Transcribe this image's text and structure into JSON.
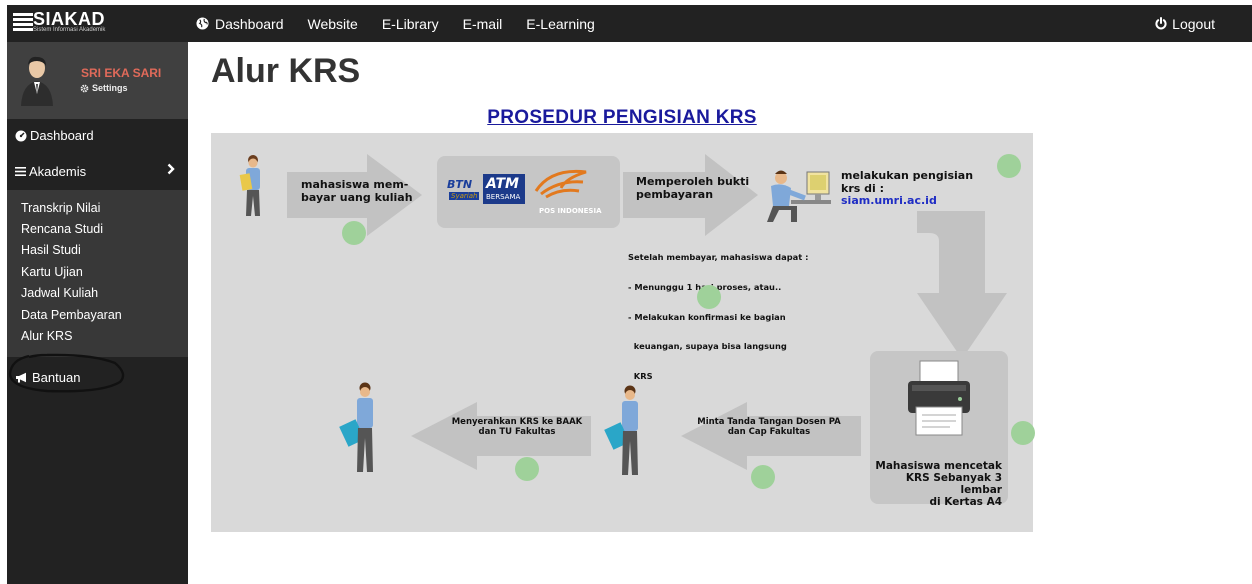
{
  "brand": {
    "name": "SIAKAD",
    "subtitle": "Sistem Informasi Akademik"
  },
  "topnav": [
    {
      "label": "Dashboard",
      "icon": "globe-icon"
    },
    {
      "label": "Website"
    },
    {
      "label": "E-Library"
    },
    {
      "label": "E-mail"
    },
    {
      "label": "E-Learning"
    }
  ],
  "logout": {
    "label": "Logout",
    "icon": "power-icon"
  },
  "user": {
    "name": "SRI EKA SARI",
    "settings_label": "Settings"
  },
  "sidebar": {
    "dashboard": "Dashboard",
    "akademis": "Akademis",
    "submenu": [
      "Transkrip Nilai",
      "Rencana Studi",
      "Hasil Studi",
      "Kartu Ujian",
      "Jadwal Kuliah",
      "Data Pembayaran",
      "Alur KRS"
    ],
    "bantuan": "Bantuan"
  },
  "page": {
    "title": "Alur KRS"
  },
  "diagram": {
    "title": "PROSEDUR PENGISIAN KRS",
    "step1": [
      "mahasiswa mem-",
      "bayar uang kuliah"
    ],
    "banks": {
      "btn": "BTN",
      "btn_sub": "Syariah",
      "atm": "ATM",
      "atm_sub": "BERSAMA",
      "pos": "POS INDONESIA"
    },
    "step2": [
      "Memperoleh bukti",
      "pembayaran"
    ],
    "note": [
      "Setelah membayar, mahasiswa dapat :",
      "- Menunggu 1 hari proses, atau..",
      "- Melakukan konfirmasi ke bagian",
      "  keuangan, supaya bisa langsung",
      "  KRS"
    ],
    "step3": [
      "melakukan pengisian",
      "krs di :"
    ],
    "url": "siam.umri.ac.id",
    "step4": [
      "Mahasiswa mencetak",
      "KRS Sebanyak 3 lembar",
      "di Kertas A4"
    ],
    "step5": [
      "Minta Tanda Tangan Dosen PA",
      "dan Cap Fakultas"
    ],
    "step6": [
      "Menyerahkan KRS ke BAAK",
      "dan TU Fakultas"
    ]
  },
  "colors": {
    "topbar": "#222222",
    "sidebar": "#222222",
    "profile": "#404040",
    "submenu": "#383838",
    "username": "#e06a5a",
    "diagram_bg": "#d9d9d9",
    "title_blue": "#1a1a9c",
    "dot_green": "#9fd19a"
  }
}
